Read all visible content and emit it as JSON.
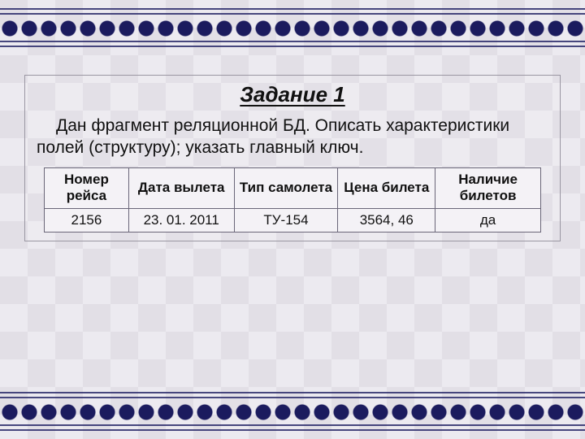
{
  "title": "Задание 1",
  "description": "Дан фрагмент реляционной БД. Описать характеристики полей (структуру); указать главный ключ.",
  "table": {
    "headers": [
      "Номер рейса",
      "Дата вылета",
      "Тип самолета",
      "Цена билета",
      "Наличие билетов"
    ],
    "rows": [
      [
        "2156",
        "23. 01. 2011",
        "ТУ-154",
        "3564, 46",
        "да"
      ]
    ]
  }
}
